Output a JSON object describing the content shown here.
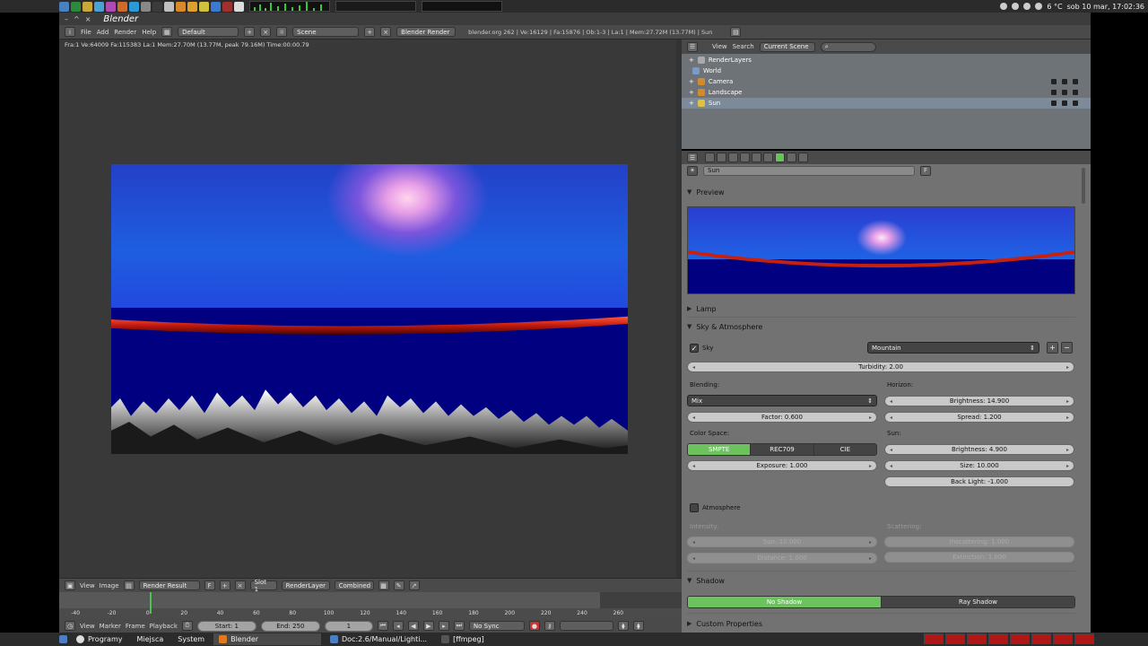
{
  "system_panel": {
    "clock": "sob 10 mar, 17:02:36",
    "temperature": "6 °C"
  },
  "window": {
    "title": "Blender"
  },
  "info_header": {
    "menus": [
      "File",
      "Add",
      "Render",
      "Help"
    ],
    "screen_layout": "Default",
    "scene": "Scene",
    "render_engine": "Blender Render",
    "stats": "blender.org 262 | Ve:16129 | Fa:15876 | Ob:1-3 | La:1 | Mem:27.72M (13.77M) | Sun"
  },
  "image_editor": {
    "render_stats": "Fra:1  Ve:64009 Fa:115383 La:1 Mem:27.70M (13.77M, peak 79.16M) Time:00:00.79",
    "header": {
      "menus": [
        "View",
        "Image"
      ],
      "image_name": "Render Result",
      "pin_label": "F",
      "slot": "Slot 1",
      "layer": "RenderLayer",
      "pass": "Combined"
    }
  },
  "timeline": {
    "ticks": [
      "-40",
      "-20",
      "0",
      "20",
      "40",
      "60",
      "80",
      "100",
      "120",
      "140",
      "160",
      "180",
      "200",
      "220",
      "240",
      "260"
    ],
    "current_frame": 1,
    "menus": [
      "View",
      "Marker",
      "Frame",
      "Playback"
    ],
    "start": "Start: 1",
    "end": "End: 250",
    "frame": "1",
    "sync": "No Sync"
  },
  "outliner": {
    "menus": [
      "View",
      "Search"
    ],
    "filter": "Current Scene",
    "items": [
      {
        "label": "RenderLayers"
      },
      {
        "label": "World"
      },
      {
        "label": "Camera"
      },
      {
        "label": "Landscape"
      },
      {
        "label": "Sun"
      }
    ]
  },
  "properties": {
    "context_name": "Sun",
    "context_pin": "F",
    "panels": {
      "preview": "Preview",
      "lamp": "Lamp",
      "sky_atmosphere": "Sky & Atmosphere",
      "shadow": "Shadow",
      "custom_properties": "Custom Properties"
    },
    "sky": {
      "checkbox_label": "Sky",
      "checked": true,
      "preset": "Mountain",
      "turbidity": "Turbidity: 2.00",
      "blending_label": "Blending:",
      "blend_mode": "Mix",
      "factor": "Factor: 0.600",
      "horizon_label": "Horizon:",
      "horizon_brightness": "Brightness: 14.900",
      "horizon_spread": "Spread: 1.200",
      "color_space_label": "Color Space:",
      "color_spaces": [
        "SMPTE",
        "REC709",
        "CIE"
      ],
      "color_space_selected": "SMPTE",
      "exposure": "Exposure: 1.000",
      "sun_label": "Sun:",
      "sun_brightness": "Brightness: 4.900",
      "sun_size": "Size: 10.000",
      "back_light": "Back Light: -1.000"
    },
    "atmosphere": {
      "checkbox_label": "Atmosphere",
      "checked": false,
      "intensity_label": "Intensity:",
      "sun": "Sun: 10.000",
      "distance": "Distance: 1.000",
      "scattering_label": "Scattering:",
      "inscattering": "Inscattering: 1.000",
      "extinction": "Extinction: 1.000"
    },
    "shadow": {
      "options": [
        "No Shadow",
        "Ray Shadow"
      ],
      "selected": "No Shadow"
    }
  },
  "taskbar": {
    "menus": [
      "Programy",
      "Miejsca",
      "System"
    ],
    "windows": [
      {
        "label": "Blender"
      },
      {
        "label": "Doc:2.6/Manual/Lighti..."
      },
      {
        "label": "[ffmpeg]"
      }
    ]
  },
  "colors": {
    "accent_green": "#6cc35d",
    "panel_bg": "#727272",
    "header_bg": "#4a4a4a"
  }
}
